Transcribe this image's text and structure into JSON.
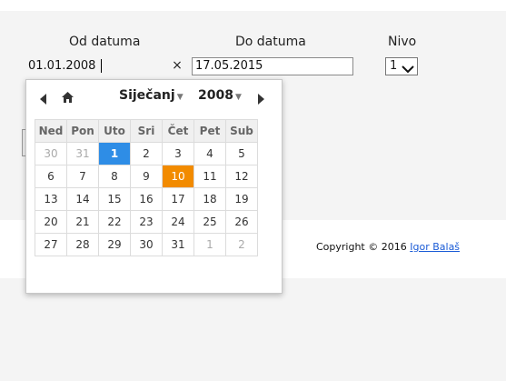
{
  "form": {
    "from_label": "Od datuma",
    "to_label": "Do datuma",
    "level_label": "Nivo",
    "from_value": "01.01.2008",
    "clear_symbol": "×",
    "to_value": "17.05.2015",
    "level_value": "1"
  },
  "calendar": {
    "month": "Siječanj",
    "year": "2008",
    "weekdays": [
      "Ned",
      "Pon",
      "Uto",
      "Sri",
      "Čet",
      "Pet",
      "Sub"
    ],
    "weeks": [
      [
        {
          "d": "30",
          "o": true
        },
        {
          "d": "31",
          "o": true
        },
        {
          "d": "1",
          "sel": true
        },
        {
          "d": "2"
        },
        {
          "d": "3"
        },
        {
          "d": "4"
        },
        {
          "d": "5"
        }
      ],
      [
        {
          "d": "6"
        },
        {
          "d": "7"
        },
        {
          "d": "8"
        },
        {
          "d": "9"
        },
        {
          "d": "10",
          "today": true
        },
        {
          "d": "11"
        },
        {
          "d": "12"
        }
      ],
      [
        {
          "d": "13"
        },
        {
          "d": "14"
        },
        {
          "d": "15"
        },
        {
          "d": "16"
        },
        {
          "d": "17"
        },
        {
          "d": "18"
        },
        {
          "d": "19"
        }
      ],
      [
        {
          "d": "20"
        },
        {
          "d": "21"
        },
        {
          "d": "22"
        },
        {
          "d": "23"
        },
        {
          "d": "24"
        },
        {
          "d": "25"
        },
        {
          "d": "26"
        }
      ],
      [
        {
          "d": "27"
        },
        {
          "d": "28"
        },
        {
          "d": "29"
        },
        {
          "d": "30"
        },
        {
          "d": "31"
        },
        {
          "d": "1",
          "o": true
        },
        {
          "d": "2",
          "o": true
        }
      ]
    ],
    "colors": {
      "selected": "#2e8de6",
      "today": "#f28b00"
    }
  },
  "footer": {
    "copyright_prefix": "Copyright © 2016",
    "author": "Igor Balaš"
  },
  "icons": [
    "arrow-left-icon",
    "home-icon",
    "arrow-right-icon",
    "chevron-down-icon"
  ]
}
